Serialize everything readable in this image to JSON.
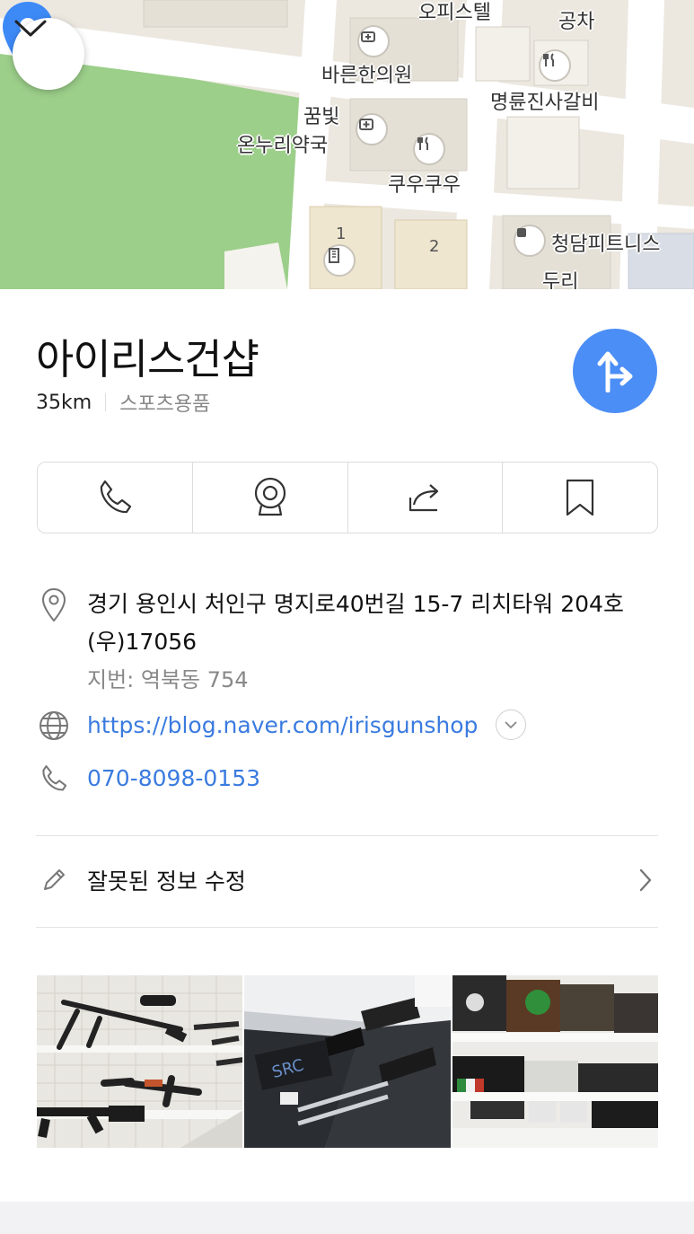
{
  "map": {
    "labels": [
      "오피스텔",
      "공차",
      "바른한의원",
      "명륜진사갈비",
      "꿈빛",
      "온누리약국",
      "쿠우쿠우",
      "청담피트니스",
      "두리"
    ],
    "building_numbers": [
      "1",
      "2"
    ]
  },
  "place": {
    "name": "아이리스건샵",
    "distance": "35km",
    "category": "스포츠용품"
  },
  "info": {
    "address": "경기 용인시 처인구 명지로40번길 15-7 리치타워 204호 (우)17056",
    "jibun": "지번: 역북동 754",
    "url": "https://blog.naver.com/irisgunshop",
    "phone": "070-8098-0153"
  },
  "fix_info_label": "잘못된 정보 수정",
  "icons": {
    "collapse": "chevron-down-icon",
    "route": "directions-icon",
    "call": "phone-icon",
    "streetview": "camera-360-icon",
    "share": "share-icon",
    "save": "bookmark-icon",
    "address": "location-pin-icon",
    "web": "globe-icon",
    "phone": "phone-icon",
    "edit": "pencil-icon",
    "more": "chevron-right-icon"
  },
  "colors": {
    "accent": "#4b8ef6",
    "link": "#3a7be0",
    "pin": "#3d8af7",
    "park": "#9ccf8a"
  }
}
